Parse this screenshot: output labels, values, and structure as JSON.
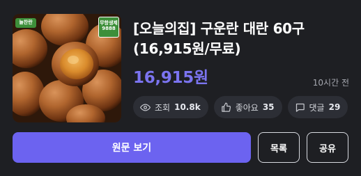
{
  "deal": {
    "title": "[오늘의집] 구운란 대란 60구 (16,915원/무료)",
    "price": "16,915원",
    "time_ago": "10시간 전",
    "thumbnail": {
      "badge_left": "늘찬란",
      "badge_right": "무항생제 9888"
    }
  },
  "stats": {
    "views": {
      "label": "조회",
      "count": "10.8k",
      "icon": "eye-icon"
    },
    "likes": {
      "label": "좋아요",
      "count": "35",
      "icon": "thumbs-up-icon"
    },
    "comments": {
      "label": "댓글",
      "count": "29",
      "icon": "comment-bubble-icon"
    }
  },
  "actions": {
    "view_original": "원문 보기",
    "list": "목록",
    "share": "공유"
  },
  "colors": {
    "background": "#1e1f23",
    "accent": "#6c63f0",
    "price": "#7b74f0",
    "pill": "#2c2e35"
  }
}
